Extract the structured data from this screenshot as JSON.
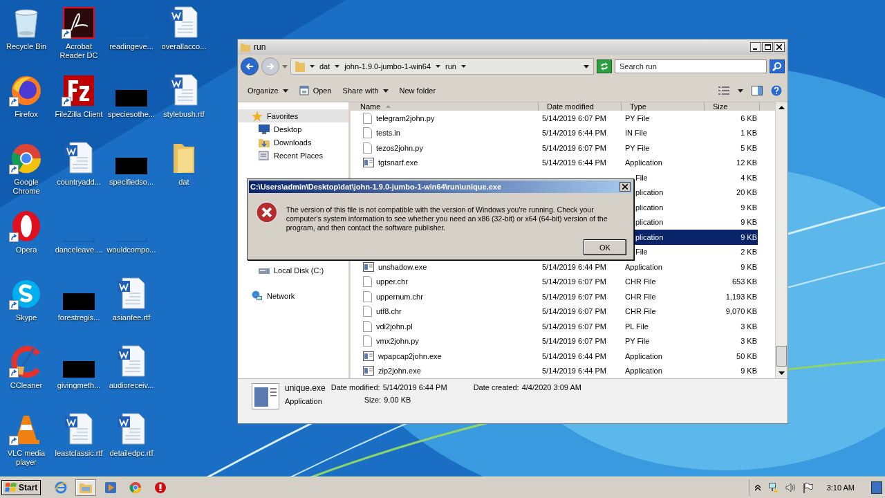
{
  "desktop": {
    "icons": [
      {
        "label": "Recycle Bin",
        "kind": "recycle",
        "shortcut": false
      },
      {
        "label": "Firefox",
        "kind": "firefox",
        "shortcut": true
      },
      {
        "label": "Google Chrome",
        "kind": "chrome",
        "shortcut": true
      },
      {
        "label": "Opera",
        "kind": "opera",
        "shortcut": true
      },
      {
        "label": "Skype",
        "kind": "skype",
        "shortcut": true
      },
      {
        "label": "CCleaner",
        "kind": "ccleaner",
        "shortcut": true
      },
      {
        "label": "VLC media player",
        "kind": "vlc",
        "shortcut": true
      },
      {
        "label": "Acrobat Reader DC",
        "kind": "acrobat",
        "shortcut": true
      },
      {
        "label": "FileZilla Client",
        "kind": "filezilla",
        "shortcut": true
      },
      {
        "label": "countryadd...",
        "kind": "word",
        "shortcut": false
      },
      {
        "label": "danceleave....",
        "kind": "blank",
        "shortcut": false
      },
      {
        "label": "forestregis...",
        "kind": "black",
        "shortcut": false
      },
      {
        "label": "givingmeth...",
        "kind": "black",
        "shortcut": false
      },
      {
        "label": "leastclassic.rtf",
        "kind": "word",
        "shortcut": false
      },
      {
        "label": "readingeve...",
        "kind": "blank",
        "shortcut": false
      },
      {
        "label": "speciesothe...",
        "kind": "black",
        "shortcut": false
      },
      {
        "label": "specifiedso...",
        "kind": "black",
        "shortcut": false
      },
      {
        "label": "wouldcompo...",
        "kind": "blank",
        "shortcut": false
      },
      {
        "label": "asianfee.rtf",
        "kind": "word",
        "shortcut": false
      },
      {
        "label": "audioreceiv...",
        "kind": "word",
        "shortcut": false
      },
      {
        "label": "detailedpc.rtf",
        "kind": "word",
        "shortcut": false
      },
      {
        "label": "overallacco...",
        "kind": "word",
        "shortcut": false
      },
      {
        "label": "stylebush.rtf",
        "kind": "word",
        "shortcut": false
      },
      {
        "label": "dat",
        "kind": "folder",
        "shortcut": false
      }
    ]
  },
  "explorer": {
    "title": "run",
    "breadcrumb": [
      "dat",
      "john-1.9.0-jumbo-1-win64",
      "run"
    ],
    "search": {
      "placeholder": "Search run"
    },
    "toolbar": [
      {
        "label": "Organize",
        "kind": "menu"
      },
      {
        "label": "Open",
        "kind": "icon"
      },
      {
        "label": "Share with",
        "kind": "menu"
      },
      {
        "label": "New folder",
        "kind": "plain"
      }
    ],
    "nav": [
      {
        "label": "Favorites",
        "kind": "star",
        "selected": true,
        "children": [
          {
            "label": "Desktop",
            "kind": "desktop",
            "selected": false
          },
          {
            "label": "Downloads",
            "kind": "downloads",
            "selected": false
          },
          {
            "label": "Recent Places",
            "kind": "recent",
            "selected": false
          }
        ]
      },
      {
        "label": "Local Disk (C:)",
        "kind": "disk",
        "selected": false
      },
      {
        "label": "Network",
        "kind": "network",
        "selected": false
      }
    ],
    "columns": [
      "Name",
      "Date modified",
      "Type",
      "Size"
    ],
    "rows": [
      {
        "kind": "file",
        "name": "telegram2john.py",
        "date": "5/14/2019 6:07 PM",
        "type": "PY File",
        "size": "6 KB",
        "selected": false
      },
      {
        "kind": "file",
        "name": "tests.in",
        "date": "5/14/2019 6:44 PM",
        "type": "IN File",
        "size": "1 KB",
        "selected": false
      },
      {
        "kind": "file",
        "name": "tezos2john.py",
        "date": "5/14/2019 6:07 PM",
        "type": "PY File",
        "size": "5 KB",
        "selected": false
      },
      {
        "kind": "exe",
        "name": "tgtsnarf.exe",
        "date": "5/14/2019 6:44 PM",
        "type": "Application",
        "size": "12 KB",
        "selected": false
      },
      {
        "kind": "partial",
        "type": "File",
        "size": "4 KB",
        "selected": false
      },
      {
        "kind": "partial",
        "type": "plication",
        "size": "20 KB",
        "selected": false
      },
      {
        "kind": "partial",
        "type": "plication",
        "size": "9 KB",
        "selected": false
      },
      {
        "kind": "partial",
        "type": "plication",
        "size": "9 KB",
        "selected": false
      },
      {
        "kind": "partial",
        "type": "plication",
        "size": "9 KB",
        "selected": true
      },
      {
        "kind": "partial",
        "type": "File",
        "size": "2 KB",
        "selected": false
      },
      {
        "kind": "exe",
        "name": "unshadow.exe",
        "date": "5/14/2019 6:44 PM",
        "type": "Application",
        "size": "9 KB",
        "selected": false
      },
      {
        "kind": "file",
        "name": "upper.chr",
        "date": "5/14/2019 6:07 PM",
        "type": "CHR File",
        "size": "653 KB",
        "selected": false
      },
      {
        "kind": "file",
        "name": "uppernum.chr",
        "date": "5/14/2019 6:07 PM",
        "type": "CHR File",
        "size": "1,193 KB",
        "selected": false
      },
      {
        "kind": "file",
        "name": "utf8.chr",
        "date": "5/14/2019 6:07 PM",
        "type": "CHR File",
        "size": "9,070 KB",
        "selected": false
      },
      {
        "kind": "file",
        "name": "vdi2john.pl",
        "date": "5/14/2019 6:07 PM",
        "type": "PL File",
        "size": "3 KB",
        "selected": false
      },
      {
        "kind": "file",
        "name": "vmx2john.py",
        "date": "5/14/2019 6:07 PM",
        "type": "PY File",
        "size": "3 KB",
        "selected": false
      },
      {
        "kind": "exe",
        "name": "wpapcap2john.exe",
        "date": "5/14/2019 6:44 PM",
        "type": "Application",
        "size": "50 KB",
        "selected": false
      },
      {
        "kind": "exe",
        "name": "zip2john.exe",
        "date": "5/14/2019 6:44 PM",
        "type": "Application",
        "size": "9 KB",
        "selected": false
      }
    ],
    "details": {
      "name": "unique.exe",
      "type": "Application",
      "modified_label": "Date modified:",
      "modified": "5/14/2019 6:44 PM",
      "size_label": "Size:",
      "size": "9.00 KB",
      "created_label": "Date created:",
      "created": "4/4/2020 3:09 AM"
    }
  },
  "dialog": {
    "title": "C:\\Users\\admin\\Desktop\\dat\\john-1.9.0-jumbo-1-win64\\run\\unique.exe",
    "message": "The version of this file is not compatible with the version of Windows you're running. Check your computer's system information to see whether you need an x86 (32-bit) or x64 (64-bit) version of the program, and then contact the software publisher.",
    "button": "OK"
  },
  "taskbar": {
    "start": "Start",
    "pinned": [
      {
        "kind": "ie",
        "selected": false
      },
      {
        "kind": "explorer",
        "selected": true
      },
      {
        "kind": "media",
        "selected": false
      },
      {
        "kind": "chrome",
        "selected": false
      },
      {
        "kind": "opera",
        "selected": false
      }
    ],
    "clock": "3:10 AM"
  }
}
